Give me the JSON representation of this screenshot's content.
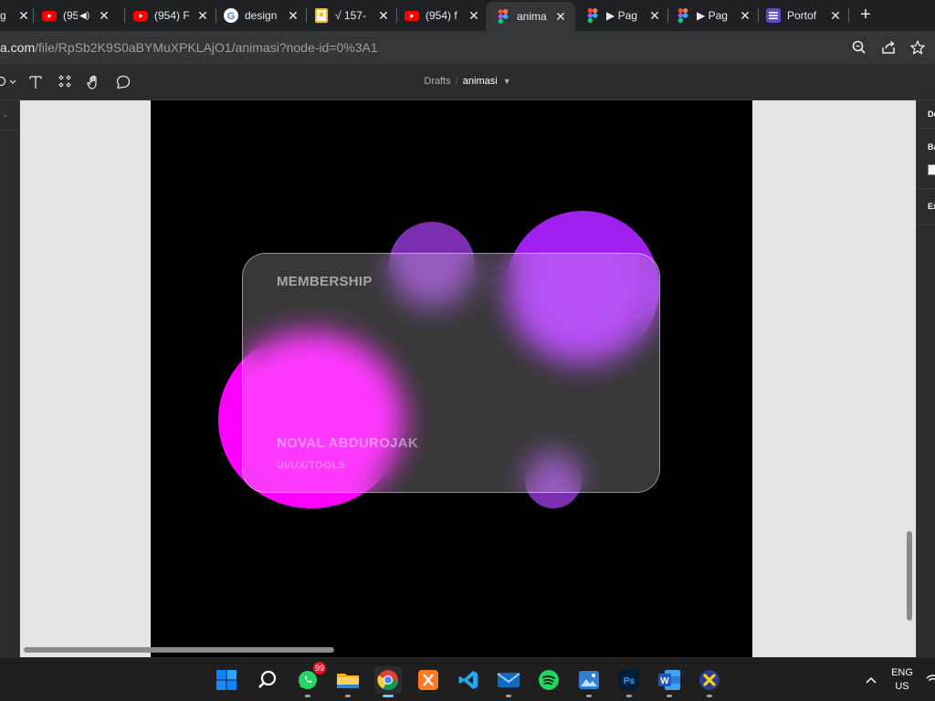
{
  "browser": {
    "tabs": [
      {
        "title": "g",
        "icon": "figma-icon",
        "closable": true
      },
      {
        "title": "(95",
        "icon": "youtube-icon",
        "closable": true,
        "audio": true
      },
      {
        "title": "(954) F",
        "icon": "youtube-icon",
        "closable": true
      },
      {
        "title": "design",
        "icon": "google-icon",
        "closable": true
      },
      {
        "title": "√ 157-",
        "icon": "keep-icon",
        "closable": true
      },
      {
        "title": "(954) f",
        "icon": "youtube-icon",
        "closable": true
      },
      {
        "title": "anima",
        "icon": "figma-icon",
        "closable": true,
        "active": true
      },
      {
        "title": "▶ Pag",
        "icon": "figma-icon",
        "closable": true
      },
      {
        "title": "▶ Pag",
        "icon": "figma-icon",
        "closable": true
      },
      {
        "title": "Portof",
        "icon": "notion-icon",
        "closable": true
      }
    ],
    "new_tab": "+",
    "url": {
      "host": "a.com",
      "path": "/file/RpSb2K9S0aBYMuXPKLAjO1/animasi?node-id=0%3A1"
    }
  },
  "figma": {
    "breadcrumb": {
      "folder": "Drafts",
      "separator": "/",
      "file": "animasi"
    },
    "right_panel": {
      "labels": [
        "De",
        "Ba",
        "Ex"
      ],
      "background_swatch": "#F5F5F5"
    },
    "canvas_bg": "#E5E5E5",
    "frame_bg": "#000000",
    "card": {
      "title": "MEMBERSHIP",
      "name": "NOVAL ABDUROJAK",
      "role": "UI/UX/TOOLS"
    },
    "colors": {
      "magenta": "#FF00FF",
      "purple": "#A020F0"
    }
  },
  "taskbar": {
    "apps": [
      {
        "name": "start-icon"
      },
      {
        "name": "search-icon"
      },
      {
        "name": "whatsapp-icon",
        "badge": "99"
      },
      {
        "name": "file-explorer-icon"
      },
      {
        "name": "chrome-icon",
        "active": true
      },
      {
        "name": "xampp-icon"
      },
      {
        "name": "vscode-icon"
      },
      {
        "name": "mail-icon"
      },
      {
        "name": "spotify-icon"
      },
      {
        "name": "photos-icon"
      },
      {
        "name": "photoshop-icon",
        "label": "Ps"
      },
      {
        "name": "word-icon",
        "label": "W"
      },
      {
        "name": "tool-x-icon"
      }
    ],
    "language": {
      "line1": "ENG",
      "line2": "US"
    }
  }
}
